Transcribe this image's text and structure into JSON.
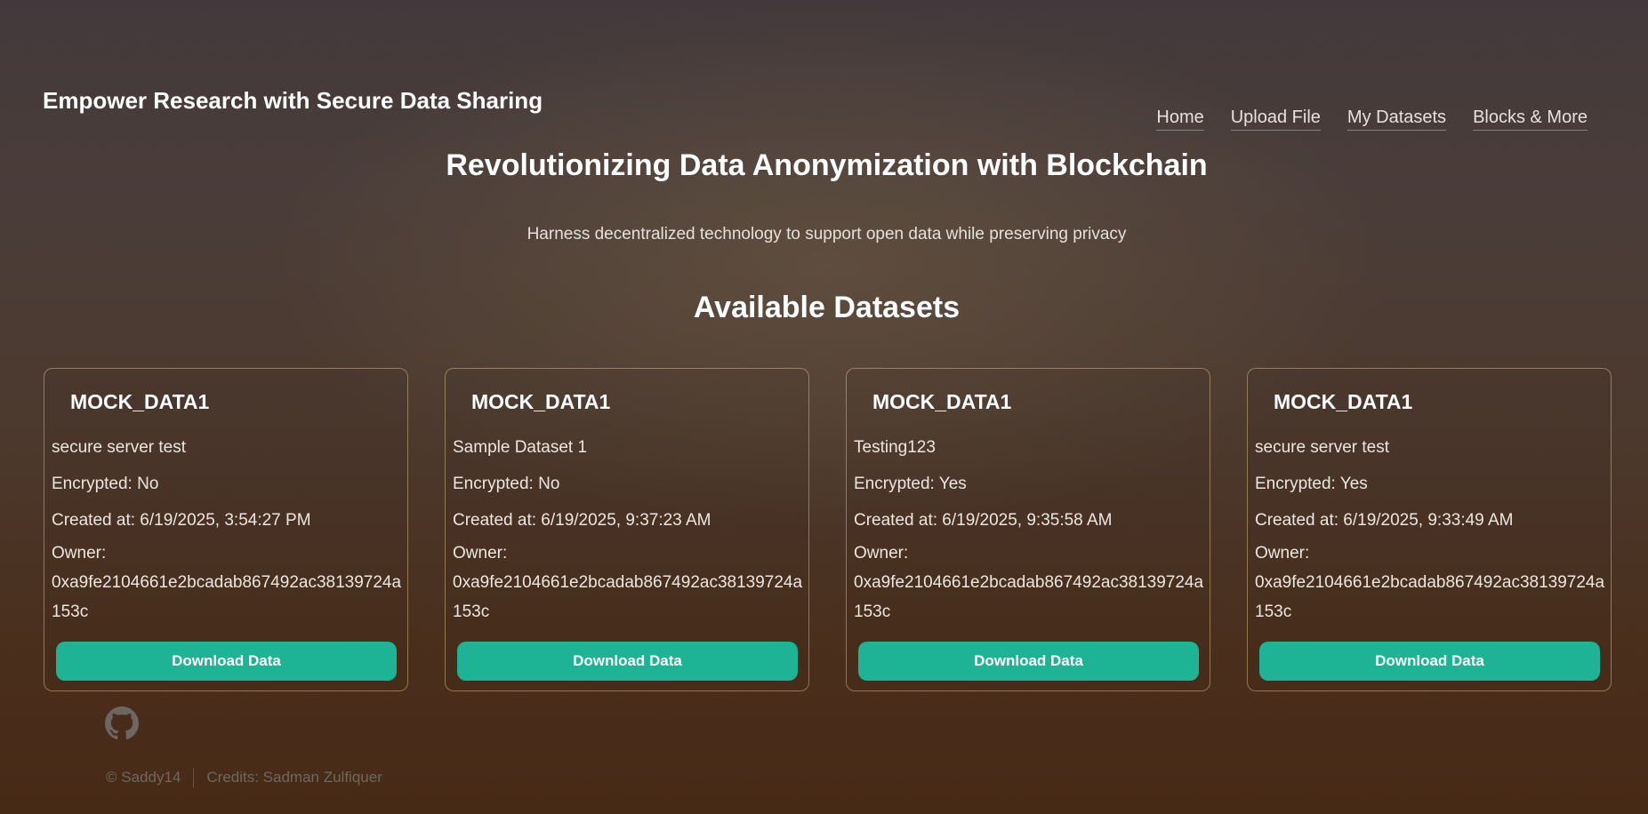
{
  "header": {
    "site_title": "Empower Research with Secure Data Sharing",
    "nav": [
      "Home",
      "Upload File",
      "My Datasets",
      "Blocks & More"
    ]
  },
  "hero": {
    "title": "Revolutionizing Data Anonymization with Blockchain",
    "subtitle": "Harness decentralized technology to support open data while preserving privacy"
  },
  "datasets": {
    "section_title": "Available Datasets",
    "download_label": "Download Data",
    "owner_label": "Owner:",
    "items": [
      {
        "name": "MOCK_DATA1",
        "description": "secure server test",
        "encrypted": "Encrypted: No",
        "created": "Created at: 6/19/2025, 3:54:27 PM",
        "owner": "0xa9fe2104661e2bcadab867492ac38139724a153c"
      },
      {
        "name": "MOCK_DATA1",
        "description": "Sample Dataset 1",
        "encrypted": "Encrypted: No",
        "created": "Created at: 6/19/2025, 9:37:23 AM",
        "owner": "0xa9fe2104661e2bcadab867492ac38139724a153c"
      },
      {
        "name": "MOCK_DATA1",
        "description": "Testing123",
        "encrypted": "Encrypted: Yes",
        "created": "Created at: 6/19/2025, 9:35:58 AM",
        "owner": "0xa9fe2104661e2bcadab867492ac38139724a153c"
      },
      {
        "name": "MOCK_DATA1",
        "description": "secure server test",
        "encrypted": "Encrypted: Yes",
        "created": "Created at: 6/19/2025, 9:33:49 AM",
        "owner": "0xa9fe2104661e2bcadab867492ac38139724a153c"
      }
    ]
  },
  "footer": {
    "icon": "github-icon",
    "copyright": "© Saddy14",
    "credits": "Credits: Sadman Zulfiquer"
  },
  "colors": {
    "button": "#1db394",
    "card_border": "#d6b482"
  }
}
